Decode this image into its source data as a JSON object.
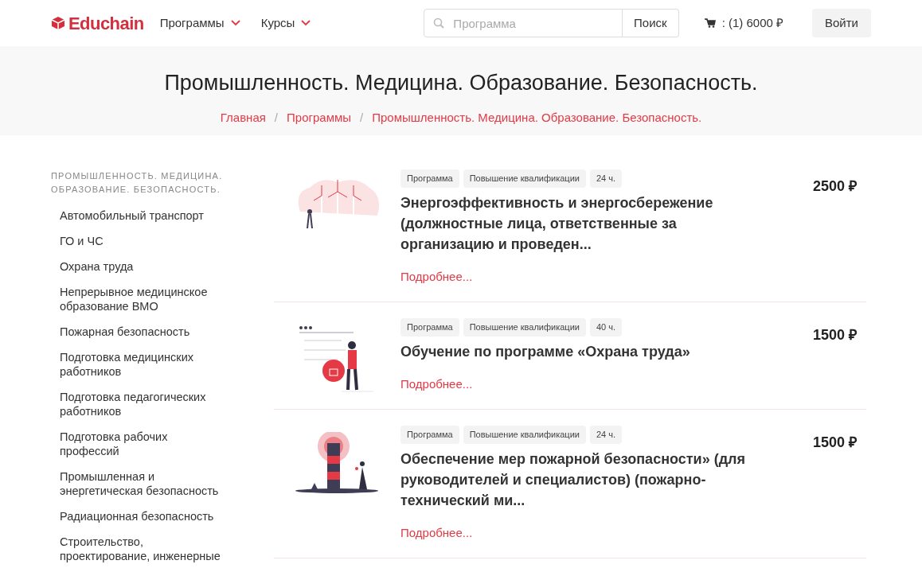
{
  "header": {
    "logo": "Educhain",
    "nav": [
      {
        "label": "Программы"
      },
      {
        "label": "Курсы"
      }
    ],
    "search": {
      "placeholder": "Программа",
      "button": "Поиск"
    },
    "cart": ": (1) 6000 ₽",
    "login": "Войти"
  },
  "hero": {
    "title": "Промышленность. Медицина. Образование. Безопасность.",
    "separator": "/",
    "breadcrumbs": [
      "Главная",
      "Программы",
      "Промышленность. Медицина. Образование. Безопасность."
    ]
  },
  "sidebar": {
    "heading": "ПРОМЫШЛЕННОСТЬ. МЕДИЦИНА. ОБРАЗОВАНИЕ. БЕЗОПАСНОСТЬ.",
    "items": [
      "Автомобильный транспорт",
      "ГО и ЧС",
      "Охрана труда",
      "Непрерывное медицинское образование ВМО",
      "Пожарная безопасность",
      "Подготовка медицинских работников",
      "Подготовка педагогических работников",
      "Подготовка рабочих профессий",
      "Промышленная и энергетическая безопасность",
      "Радиационная безопасность",
      "Строительство, проектирование, инженерные"
    ]
  },
  "programs": [
    {
      "tags": [
        "Программа",
        "Повышение квалификации",
        "24 ч."
      ],
      "title": "Энергоэффективность и энергосбережение (должностные лица, ответственные за организацию и проведен...",
      "link": "Подробнее...",
      "price": "2500 ₽"
    },
    {
      "tags": [
        "Программа",
        "Повышение квалификации",
        "40 ч."
      ],
      "title": "Обучение по программе «Охрана труда»",
      "link": "Подробнее...",
      "price": "1500 ₽"
    },
    {
      "tags": [
        "Программа",
        "Повышение квалификации",
        "24 ч."
      ],
      "title": "Обеспечение мер пожарной безопасности» (для руководителей и специалистов) (пожарно-технический ми...",
      "link": "Подробнее...",
      "price": "1500 ₽"
    }
  ]
}
